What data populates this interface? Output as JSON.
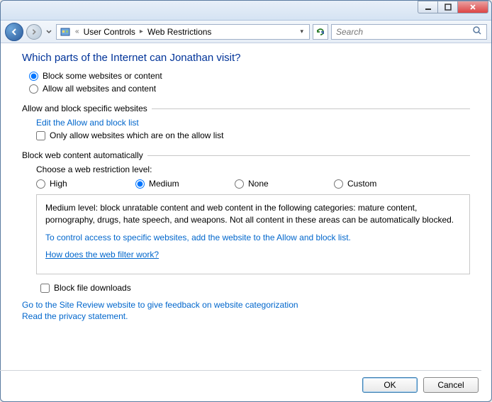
{
  "titlebar": {
    "title": ""
  },
  "nav": {
    "breadcrumb": [
      "User Controls",
      "Web Restrictions"
    ],
    "search_placeholder": "Search"
  },
  "heading": "Which parts of the Internet can Jonathan visit?",
  "main_radios": {
    "block_some": "Block some websites or content",
    "allow_all": "Allow all websites and content",
    "selected": "block_some"
  },
  "section_allow_block": {
    "label": "Allow and block specific websites",
    "edit_link": "Edit the Allow and block list",
    "only_allow_cb": "Only allow websites which are on the allow list"
  },
  "section_auto": {
    "label": "Block web content automatically",
    "choose_label": "Choose a web restriction level:",
    "levels": {
      "high": "High",
      "medium": "Medium",
      "none": "None",
      "custom": "Custom",
      "selected": "medium"
    },
    "desc": "Medium level:  block unratable content and web content in the following categories:  mature content, pornography, drugs, hate speech, and weapons.  Not all content in these areas can be automatically blocked.",
    "desc_link": "To control access to specific websites, add the website to the Allow and block list.",
    "how_link": "How does the web filter work?"
  },
  "block_downloads_cb": "Block file downloads",
  "footer_links": {
    "site_review": "Go to the Site Review website to give feedback on website categorization",
    "privacy": "Read the privacy statement."
  },
  "buttons": {
    "ok": "OK",
    "cancel": "Cancel"
  }
}
